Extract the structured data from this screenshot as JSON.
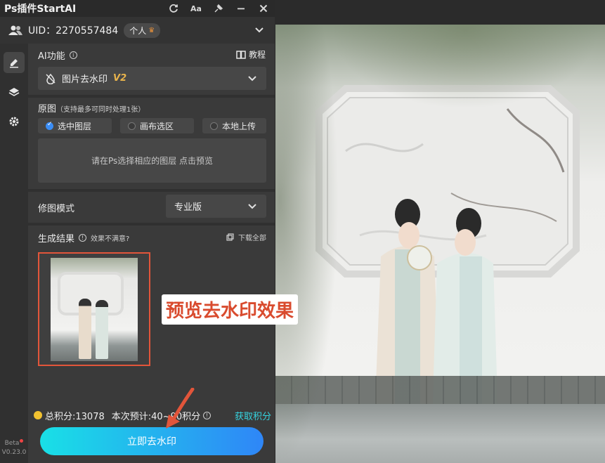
{
  "window": {
    "title": "Ps插件StartAI"
  },
  "user": {
    "uid_text": "UID：2270557484",
    "badge": "个人"
  },
  "sections": {
    "ai_function": {
      "label": "AI功能",
      "tutorial": "教程",
      "selected": "图片去水印",
      "version": "V2"
    },
    "source": {
      "label": "原图",
      "hint": "（支持最多可同时处理1张）",
      "options": [
        "选中图层",
        "画布选区",
        "本地上传"
      ],
      "selected_index": 0,
      "preview_hint": "请在Ps选择相应的图层 点击预览"
    },
    "mode": {
      "label": "修图模式",
      "value": "专业版"
    },
    "result": {
      "label": "生成结果",
      "feedback": "效果不满意?",
      "download": "下载全部"
    }
  },
  "callout": "预览去水印效果",
  "footer": {
    "total_points": "总积分:13078",
    "estimate": "本次预计:40~90积分",
    "get_points": "获取积分",
    "action_button": "立即去水印",
    "beta": "Beta",
    "version": "V0.23.0"
  },
  "colors": {
    "accent_start": "#19e0e6",
    "accent_end": "#2f86f7",
    "highlight": "#e2553a",
    "callout_text": "#d94b2e"
  },
  "icons": [
    "refresh-icon",
    "font-size-icon",
    "pin-icon",
    "minimize-icon",
    "close-icon",
    "users-icon",
    "chevron-down-icon",
    "edit-icon",
    "layers-icon",
    "gear-icon",
    "info-icon",
    "book-icon",
    "watermark-icon",
    "download-icon",
    "coin-icon"
  ]
}
